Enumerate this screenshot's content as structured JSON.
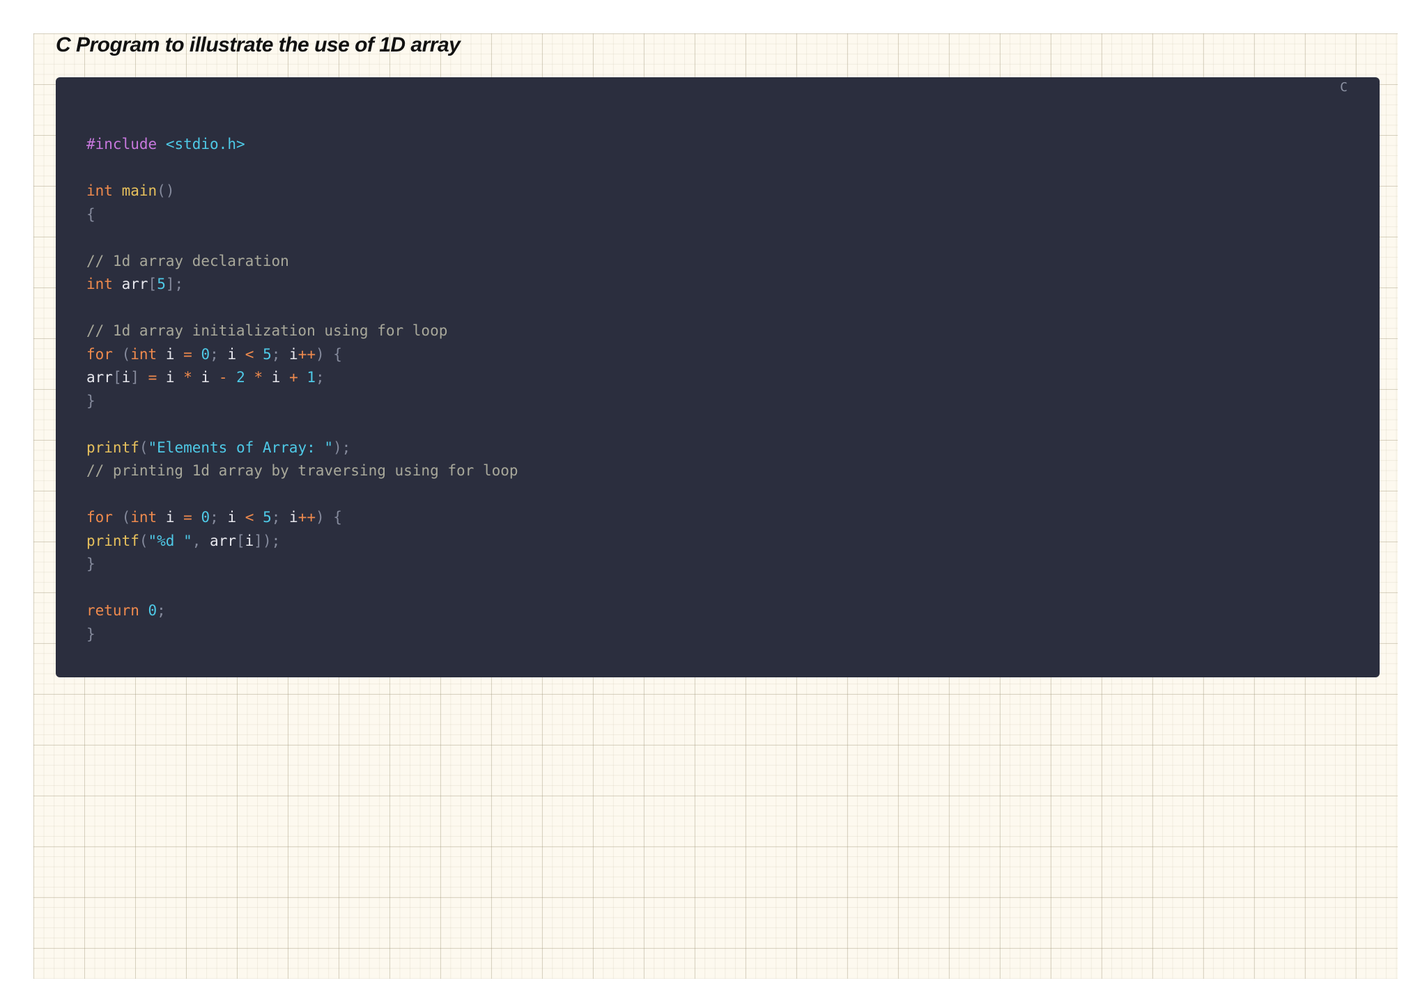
{
  "page": {
    "title": "C Program to illustrate the use of 1D array"
  },
  "code_block": {
    "language": "C",
    "tokens": {
      "t1": "#include",
      "t2": "<stdio.h>",
      "t3": "int",
      "t4": "main",
      "t5": "()",
      "t6": "{",
      "t7": "// 1d array declaration",
      "t8": "int",
      "t9": "arr",
      "t10": "[",
      "t11": "5",
      "t12": "];",
      "t13": "// 1d array initialization using for loop",
      "t14": "for",
      "t15": "(",
      "t16": "int",
      "t17": "i",
      "t18": "=",
      "t19": "0",
      "t20": ";",
      "t21": "i",
      "t22": "<",
      "t23": "5",
      "t24": ";",
      "t25": "i",
      "t26": "++",
      "t27": ")",
      "t28": "{",
      "t29": "arr",
      "t30": "[",
      "t31": "i",
      "t32": "]",
      "t33": "=",
      "t34": "i",
      "t35": "*",
      "t36": "i",
      "t37": "-",
      "t38": "2",
      "t39": "*",
      "t40": "i",
      "t41": "+",
      "t42": "1",
      "t43": ";",
      "t44": "}",
      "t45": "printf",
      "t46": "(",
      "t47": "\"Elements of Array: \"",
      "t48": ");",
      "t49": "// printing 1d array by traversing using for loop",
      "t50": "for",
      "t51": "(",
      "t52": "int",
      "t53": "i",
      "t54": "=",
      "t55": "0",
      "t56": ";",
      "t57": "i",
      "t58": "<",
      "t59": "5",
      "t60": ";",
      "t61": "i",
      "t62": "++",
      "t63": ")",
      "t64": "{",
      "t65": "printf",
      "t66": "(",
      "t67": "\"%d \"",
      "t68": ",",
      "t69": "arr",
      "t70": "[",
      "t71": "i",
      "t72": "]);",
      "t73": "}",
      "t74": "return",
      "t75": "0",
      "t76": ";",
      "t77": "}"
    }
  }
}
